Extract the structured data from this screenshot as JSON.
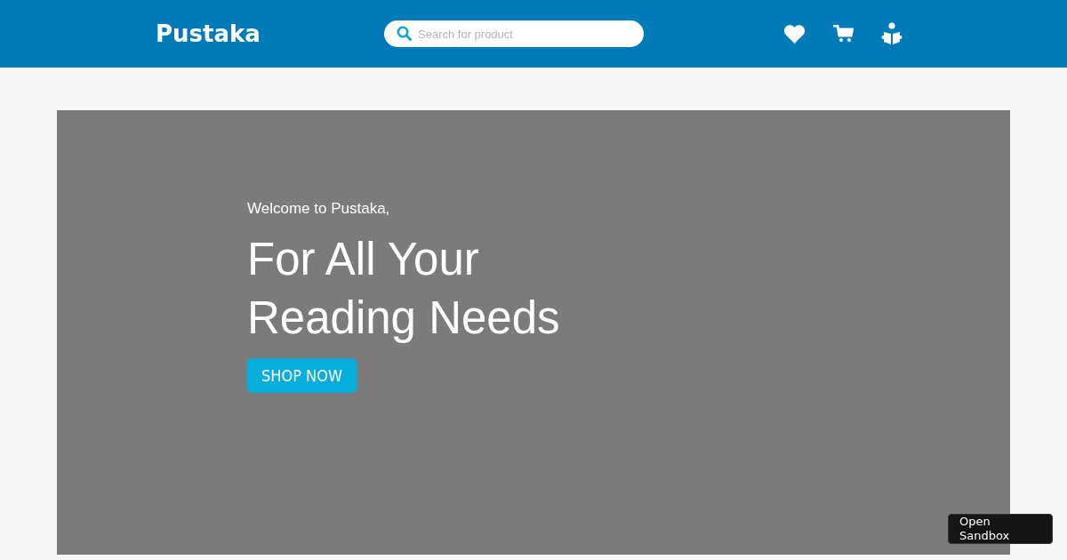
{
  "header": {
    "logo": "Pustaka",
    "search": {
      "placeholder": "Search for product"
    }
  },
  "hero": {
    "welcome": "Welcome to Pustaka,",
    "headline": "For All Your Reading Needs",
    "button": "SHOP NOW"
  },
  "sandbox_button": "Open Sandbox"
}
